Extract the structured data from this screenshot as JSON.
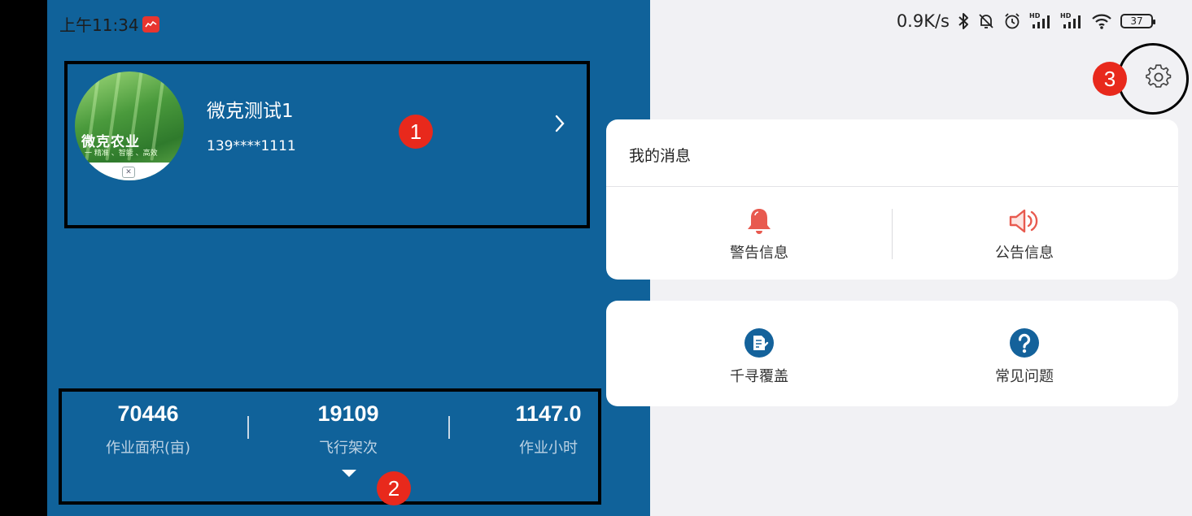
{
  "status_bar": {
    "time": "上午11:34",
    "net_speed": "0.9K/s",
    "battery": "37",
    "network_badge": "HD",
    "icons": [
      "app-badge-icon",
      "bluetooth-icon",
      "bell-muted-icon",
      "alarm-icon",
      "signal-icon",
      "wifi-icon",
      "battery-icon"
    ]
  },
  "profile": {
    "avatar_title": "微克农业",
    "avatar_subtitle": "一 精准 、智能 、高效",
    "name": "微克测试1",
    "phone": "139****1111"
  },
  "stats": [
    {
      "value": "70446",
      "label": "作业面积(亩)"
    },
    {
      "value": "19109",
      "label": "飞行架次"
    },
    {
      "value": "1147.0",
      "label": "作业小时"
    }
  ],
  "markers": [
    "1",
    "2",
    "3"
  ],
  "messages": {
    "title": "我的消息",
    "items": [
      {
        "label": "警告信息",
        "icon": "warning-bell-icon"
      },
      {
        "label": "公告信息",
        "icon": "announcement-speaker-icon"
      }
    ]
  },
  "tools": {
    "items": [
      {
        "label": "千寻覆盖",
        "icon": "coverage-document-icon"
      },
      {
        "label": "常见问题",
        "icon": "faq-question-icon"
      }
    ]
  },
  "colors": {
    "panel_blue": "#10629a",
    "panel_grey": "#f1f1f4",
    "accent_red": "#e85a4f",
    "icon_blue": "#14629b",
    "marker_red": "#e8291c"
  }
}
